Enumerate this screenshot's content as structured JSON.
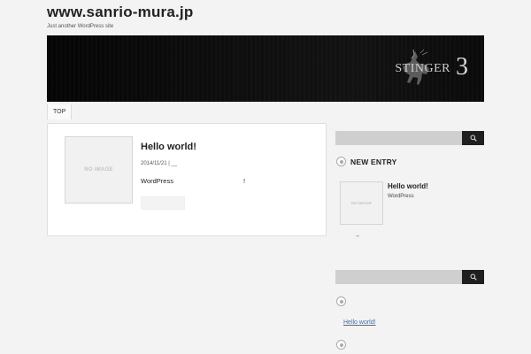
{
  "site": {
    "title": "www.sanrio-mura.jp",
    "tagline": "Just another WordPress site"
  },
  "banner": {
    "logo_text": "STINGER",
    "logo_num": "3"
  },
  "nav": {
    "items": [
      {
        "label": "TOP"
      }
    ]
  },
  "post": {
    "thumb_label": "NO IMAGE",
    "title": "Hello world!",
    "meta": "2014/11/21 | __",
    "excerpt": "WordPress",
    "excerpt_end": "!"
  },
  "sidebar": {
    "search_top": {
      "placeholder": ""
    },
    "new_entry": {
      "title": "NEW ENTRY",
      "item": {
        "thumb_label": "NO IMAGE",
        "title": "Hello world!",
        "excerpt": "WordPress"
      },
      "arrow": "→"
    },
    "search_bottom": {
      "placeholder": ""
    },
    "recent_link": "Hello world!"
  },
  "colors": {
    "background": "#f3f3f3",
    "search_button": "#1f1f1f",
    "link": "#3b6fbf"
  }
}
